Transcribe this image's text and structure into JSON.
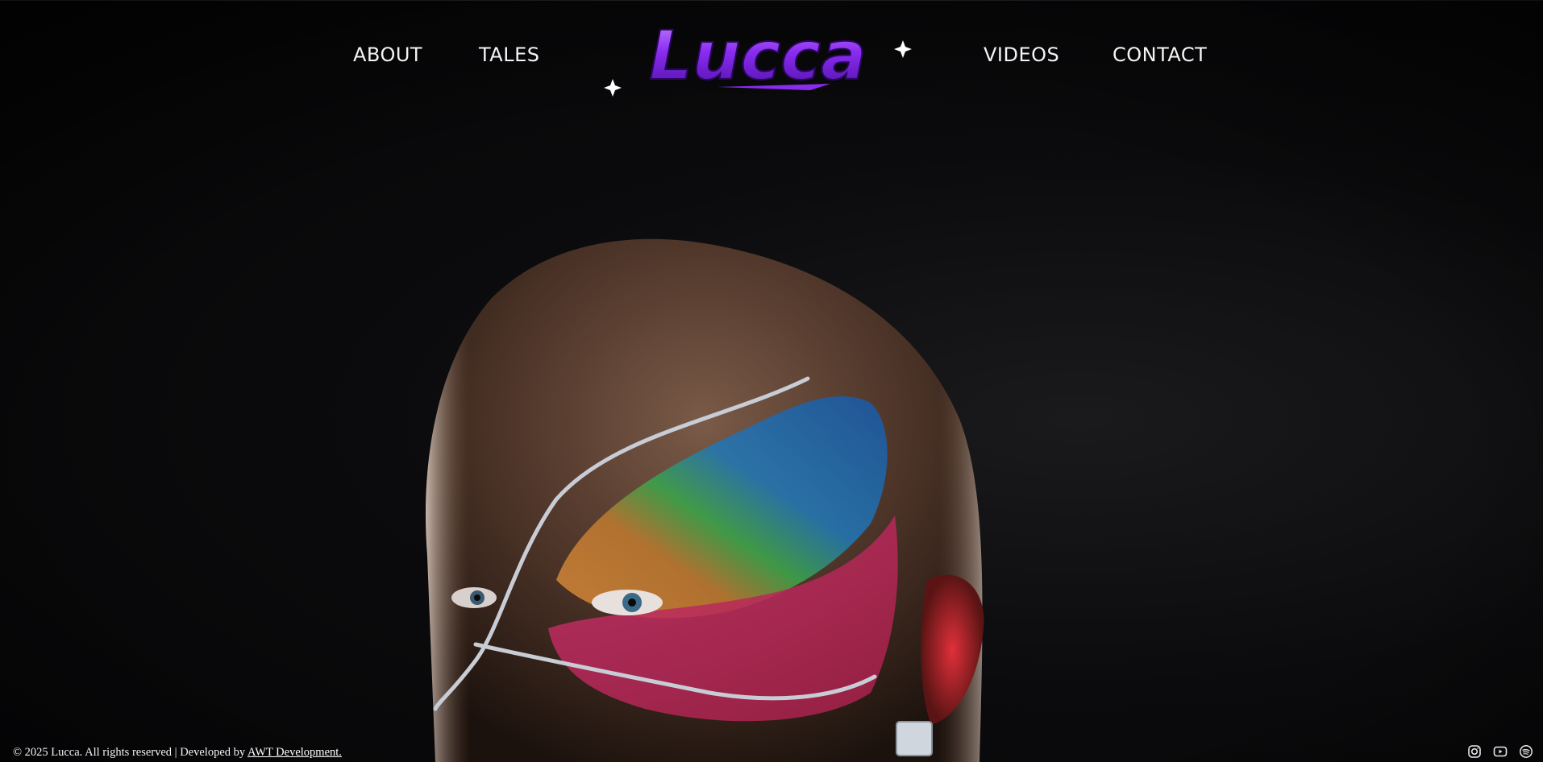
{
  "brand": {
    "logo_text": "Lucca",
    "accent": "#8a2cf0",
    "accent_light": "#c27bff"
  },
  "nav": {
    "left": [
      {
        "label": "ABOUT"
      },
      {
        "label": "TALES"
      }
    ],
    "right": [
      {
        "label": "VIDEOS"
      },
      {
        "label": "CONTACT"
      }
    ]
  },
  "footer": {
    "copyright": "© 2025 Lucca. All rights reserved | Developed by ",
    "developer_link": "AWT Development."
  },
  "social": {
    "icons": [
      "instagram-icon",
      "youtube-icon",
      "spotify-icon"
    ]
  }
}
